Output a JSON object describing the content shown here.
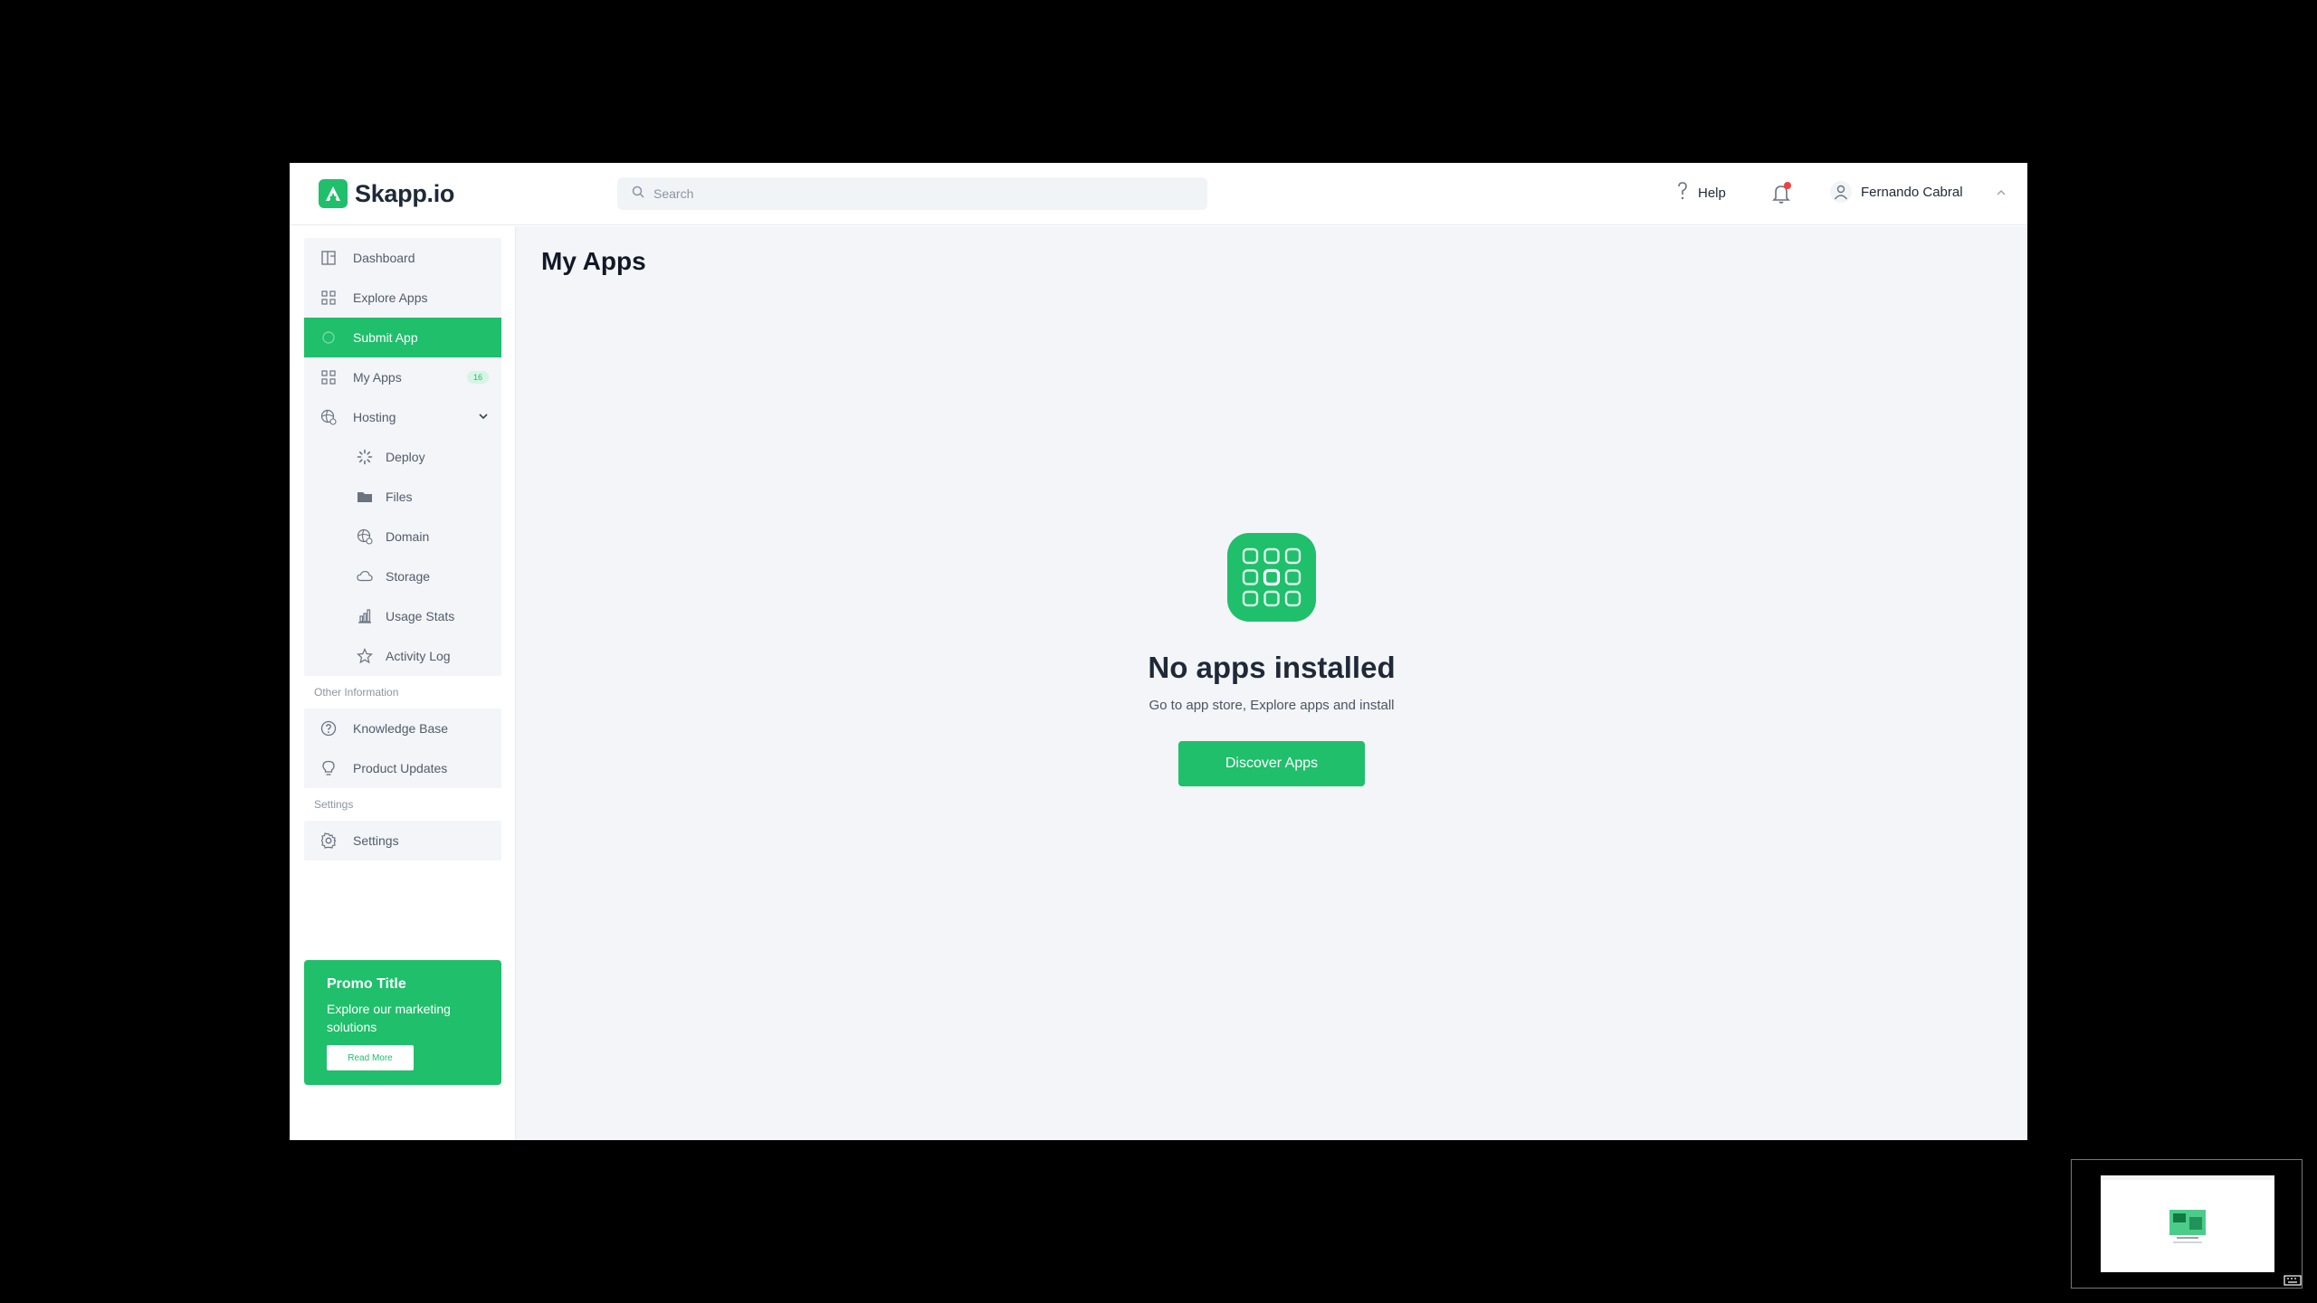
{
  "header": {
    "brand": "Skapp.io",
    "search_placeholder": "Search",
    "help_label": "Help",
    "user_name": "Fernando Cabral"
  },
  "sidebar": {
    "items": [
      {
        "label": "Dashboard",
        "icon": "dashboard-icon"
      },
      {
        "label": "Explore Apps",
        "icon": "grid-icon"
      },
      {
        "label": "Submit App",
        "icon": "submit-icon",
        "active": true
      },
      {
        "label": "My Apps",
        "icon": "grid-icon",
        "badge": "16"
      },
      {
        "label": "Hosting",
        "icon": "hosting-icon",
        "expanded": true
      }
    ],
    "hosting_items": [
      {
        "label": "Deploy",
        "icon": "deploy-icon"
      },
      {
        "label": "Files",
        "icon": "folder-icon"
      },
      {
        "label": "Domain",
        "icon": "globe-icon"
      },
      {
        "label": "Storage",
        "icon": "cloud-icon"
      },
      {
        "label": "Usage Stats",
        "icon": "bar-chart-icon"
      },
      {
        "label": "Activity Log",
        "icon": "star-icon"
      }
    ],
    "other_info_label": "Other Information",
    "other_items": [
      {
        "label": "Knowledge Base",
        "icon": "question-icon"
      },
      {
        "label": "Product Updates",
        "icon": "bulb-icon"
      }
    ],
    "settings_section_label": "Settings",
    "settings_item": {
      "label": "Settings",
      "icon": "gear-icon"
    },
    "promo": {
      "title": "Promo Title",
      "text": "Explore our marketing solutions",
      "button": "Read More"
    }
  },
  "main": {
    "title": "My Apps",
    "empty_title": "No apps installed",
    "empty_subtitle": "Go to app store, Explore apps and install",
    "discover_button": "Discover Apps"
  },
  "colors": {
    "accent": "#1fbf6b",
    "sidebar_bg": "#f3f5f8",
    "main_bg": "#f3f5f8",
    "notification_dot": "#f43f3f"
  }
}
